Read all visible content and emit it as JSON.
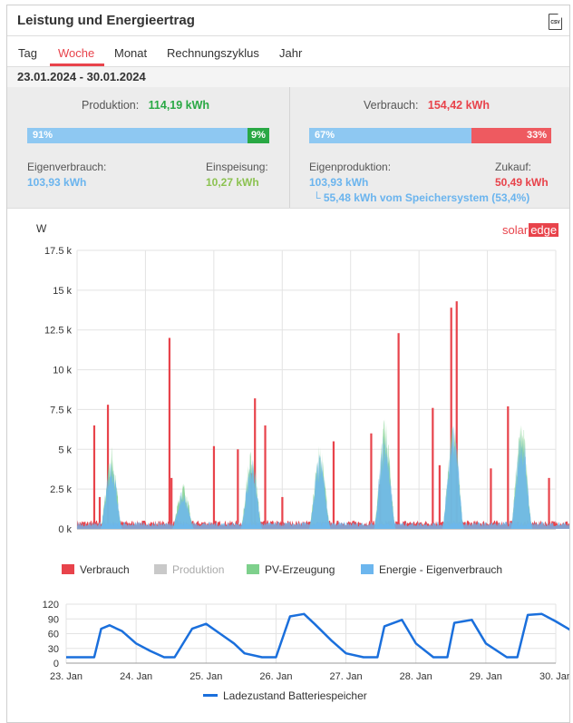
{
  "header": {
    "title": "Leistung und Energieertrag",
    "csv_icon_text": "CSV"
  },
  "tabs": [
    {
      "label": "Tag"
    },
    {
      "label": "Woche"
    },
    {
      "label": "Monat"
    },
    {
      "label": "Rechnungszyklus"
    },
    {
      "label": "Jahr"
    }
  ],
  "active_tab": "Woche",
  "date_range": "23.01.2024 - 30.01.2024",
  "production": {
    "label": "Produktion:",
    "value": "114,19 kWh",
    "bar": {
      "self_pct": 91,
      "self_label": "91%",
      "feed_pct": 9,
      "feed_label": "9%"
    },
    "self_label": "Eigenverbrauch:",
    "self_value": "103,93 kWh",
    "feed_label": "Einspeisung:",
    "feed_value": "10,27 kWh"
  },
  "consumption": {
    "label": "Verbrauch:",
    "value": "154,42 kWh",
    "bar": {
      "own_pct": 67,
      "own_label": "67%",
      "buy_pct": 33,
      "buy_label": "33%"
    },
    "own_label": "Eigenproduktion:",
    "own_value": "103,93 kWh",
    "buy_label": "Zukauf:",
    "buy_value": "50,49 kWh",
    "storage_note": "└ 55,48 kWh vom Speichersystem (53,4%)"
  },
  "logo": {
    "solar": "solar",
    "edge": "edge"
  },
  "colors": {
    "verbrauch": "#e8434b",
    "produktion": "#c9c9c9",
    "pv": "#7ed08c",
    "eigen": "#6cb6ee",
    "battery": "#1a6fdc"
  },
  "chart_data": [
    {
      "type": "area",
      "ylabel": "W",
      "ylim": [
        0,
        17500
      ],
      "y_ticks": [
        "0 k",
        "2.5 k",
        "5 k",
        "7.5 k",
        "10 k",
        "12.5 k",
        "15 k",
        "17.5 k"
      ],
      "x_ticks": [
        "23. Jan",
        "24. Jan",
        "25. Jan",
        "26. Jan",
        "27. Jan",
        "28. Jan",
        "29. Jan",
        "30. Jan"
      ],
      "legend": [
        "Verbrauch",
        "Produktion",
        "PV-Erzeugung",
        "Energie - Eigenverbrauch"
      ],
      "x_units": "days since 23. Jan",
      "series": [
        {
          "name": "Verbrauch",
          "peaks": [
            [
              0.25,
              6500
            ],
            [
              0.33,
              2000
            ],
            [
              0.45,
              7800
            ],
            [
              1.35,
              12000
            ],
            [
              1.38,
              3200
            ],
            [
              2.0,
              5200
            ],
            [
              2.35,
              5000
            ],
            [
              2.55,
              3500
            ],
            [
              2.6,
              8200
            ],
            [
              2.75,
              6500
            ],
            [
              3.0,
              2000
            ],
            [
              3.75,
              5500
            ],
            [
              4.3,
              6000
            ],
            [
              4.43,
              2800
            ],
            [
              4.7,
              12300
            ],
            [
              5.2,
              7600
            ],
            [
              5.3,
              4000
            ],
            [
              5.47,
              13900
            ],
            [
              5.55,
              14300
            ],
            [
              6.05,
              3800
            ],
            [
              6.3,
              7700
            ],
            [
              6.9,
              3200
            ],
            [
              7.5,
              1000
            ]
          ]
        },
        {
          "name": "PV-Erzeugung",
          "humps": [
            [
              0.5,
              5200
            ],
            [
              1.55,
              3000
            ],
            [
              2.55,
              5000
            ],
            [
              3.55,
              5300
            ],
            [
              4.5,
              7000
            ],
            [
              5.5,
              6800
            ],
            [
              6.5,
              7000
            ],
            [
              7.45,
              1500
            ]
          ]
        },
        {
          "name": "Energie - Eigenverbrauch",
          "humps": [
            [
              0.5,
              4700
            ],
            [
              1.55,
              2500
            ],
            [
              2.55,
              4500
            ],
            [
              3.55,
              4800
            ],
            [
              4.5,
              6300
            ],
            [
              5.5,
              7000
            ],
            [
              6.5,
              6500
            ],
            [
              7.45,
              1300
            ]
          ]
        }
      ]
    },
    {
      "type": "line",
      "ylim": [
        0,
        120
      ],
      "y_ticks": [
        "0",
        "30",
        "60",
        "90",
        "120"
      ],
      "x_ticks": [
        "23. Jan",
        "24. Jan",
        "25. Jan",
        "26. Jan",
        "27. Jan",
        "28. Jan",
        "29. Jan",
        "30. Jan"
      ],
      "series": [
        {
          "name": "Ladezustand Batteriespeicher",
          "x": [
            0,
            0.4,
            0.5,
            0.62,
            0.8,
            1.0,
            1.2,
            1.4,
            1.55,
            1.8,
            2.0,
            2.2,
            2.4,
            2.55,
            2.8,
            3.0,
            3.2,
            3.4,
            3.55,
            3.8,
            4.0,
            4.25,
            4.45,
            4.55,
            4.8,
            5.0,
            5.25,
            5.45,
            5.55,
            5.8,
            6.0,
            6.3,
            6.45,
            6.6,
            6.8,
            7.0,
            7.3,
            7.45
          ],
          "y": [
            12,
            12,
            70,
            77,
            65,
            40,
            25,
            12,
            12,
            70,
            80,
            60,
            40,
            20,
            12,
            12,
            95,
            100,
            80,
            45,
            20,
            12,
            12,
            75,
            88,
            40,
            12,
            12,
            82,
            88,
            40,
            12,
            12,
            98,
            100,
            85,
            60,
            35
          ]
        }
      ]
    }
  ]
}
